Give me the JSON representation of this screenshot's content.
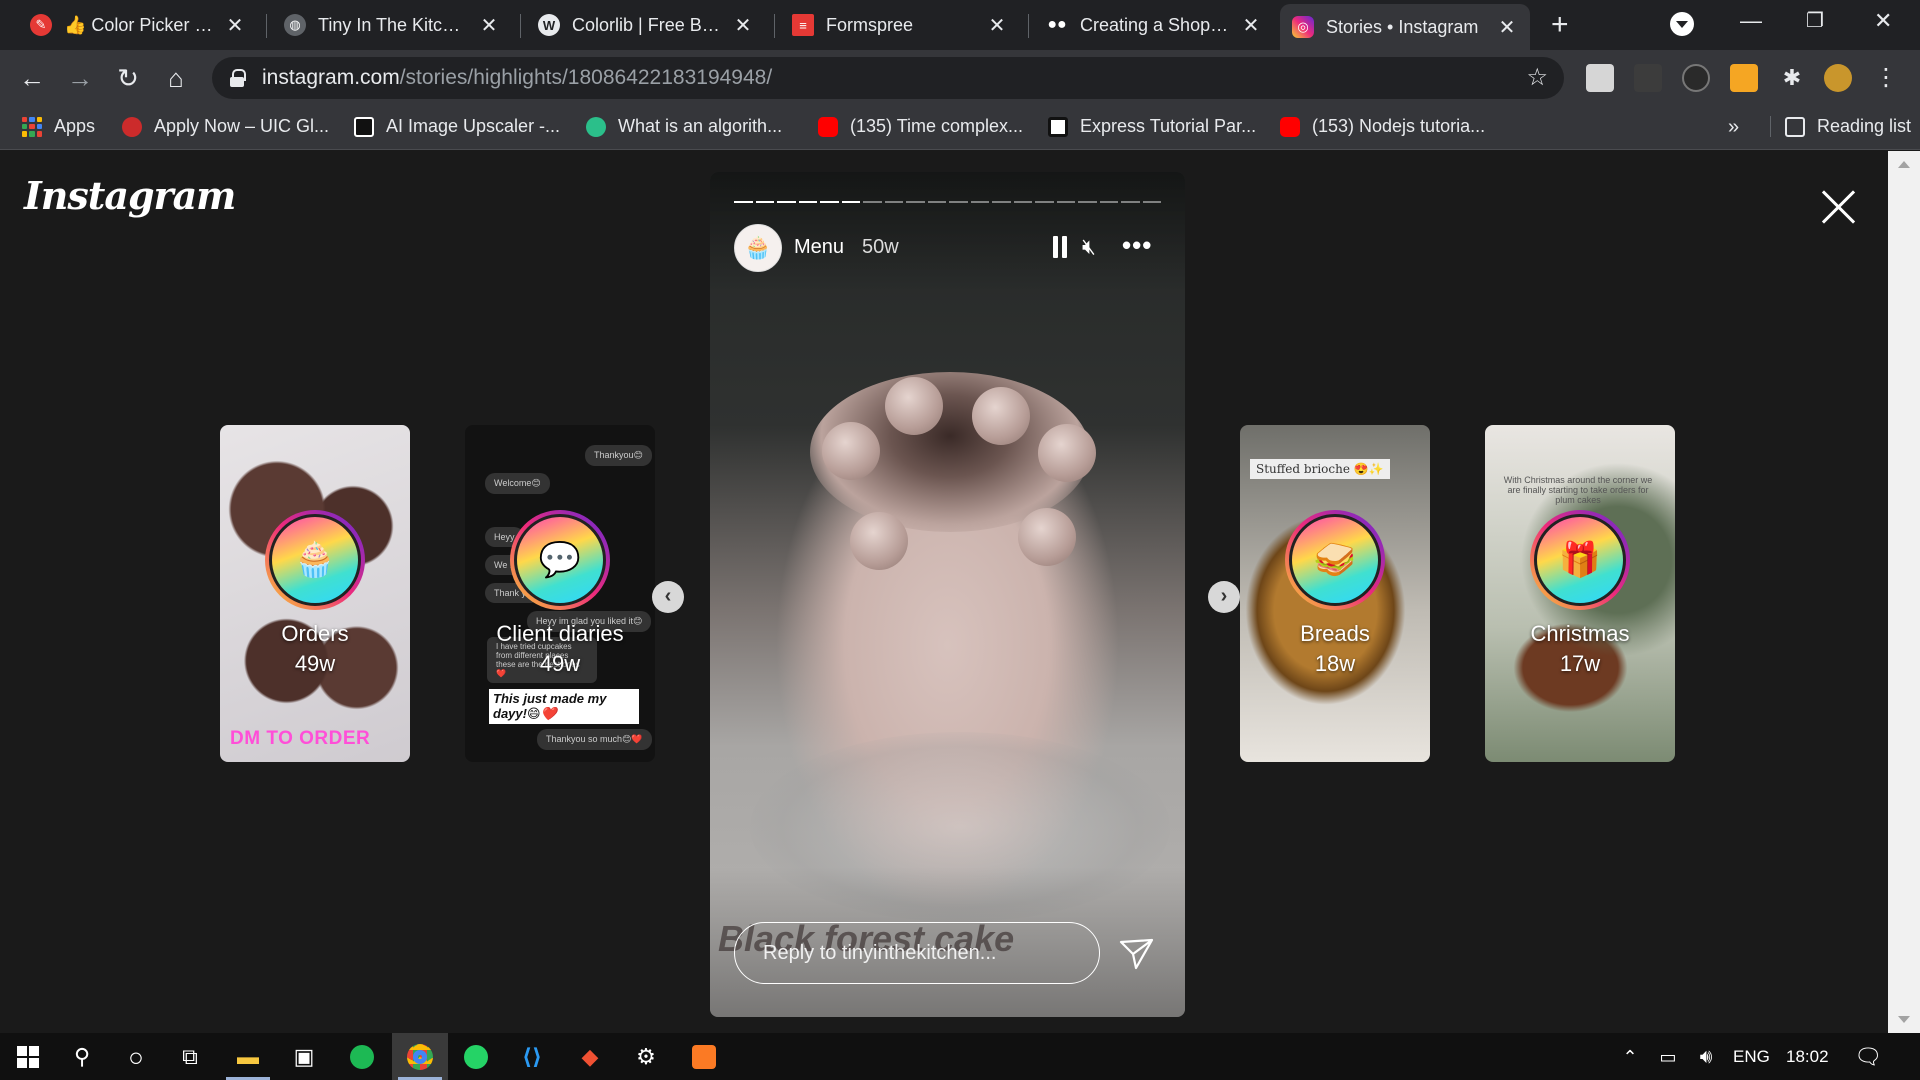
{
  "browser": {
    "tabs": [
      {
        "title": "👍 Color Picker onli",
        "icon": "color-picker-icon",
        "color": "#e53935"
      },
      {
        "title": "Tiny In The Kitchen",
        "icon": "globe-icon",
        "color": "#5f6368"
      },
      {
        "title": "Colorlib | Free Boots",
        "icon": "wordpress-icon",
        "color": "#5f6368"
      },
      {
        "title": "Formspree",
        "icon": "formspree-icon",
        "color": "#e53935"
      },
      {
        "title": "Creating a Shoppin",
        "icon": "medium-icon",
        "color": "#000000"
      },
      {
        "title": "Stories • Instagram",
        "icon": "instagram-icon",
        "color": "#d6249f"
      }
    ],
    "address": {
      "host": "instagram.com",
      "path": "/stories/highlights/18086422183194948/"
    },
    "bookmarks": [
      {
        "label": "Apps",
        "icon": "apps-grid-icon"
      },
      {
        "label": "Apply Now – UIC Gl...",
        "icon": "uic-icon",
        "color": "#cc2b2b"
      },
      {
        "label": "AI Image Upscaler -...",
        "icon": "upscaler-icon",
        "color": "#111111"
      },
      {
        "label": "What is an algorith...",
        "icon": "shield-icon",
        "color": "#2bbf8a"
      },
      {
        "label": "(135) Time complex...",
        "icon": "youtube-icon",
        "color": "#ff0000"
      },
      {
        "label": "Express Tutorial Par...",
        "icon": "express-icon",
        "color": "#111111"
      },
      {
        "label": "(153) Nodejs tutoria...",
        "icon": "youtube-icon",
        "color": "#ff0000"
      }
    ],
    "more_bookmarks": "»",
    "reading_list": "Reading list"
  },
  "instagram": {
    "logo": "Instagram",
    "story": {
      "username": "Menu",
      "age": "50w",
      "caption": "Black forest cake",
      "reply_placeholder": "Reply to tinyinthekitchen...",
      "segments_total": 20,
      "segments_done": 6
    },
    "highlights": [
      {
        "name": "Orders",
        "age": "49w",
        "caption": "DM TO ORDER",
        "icon": "cupcake-icon"
      },
      {
        "name": "Client diaries",
        "age": "49w",
        "caption": "",
        "icon": "chat-icon"
      },
      {
        "name": "Breads",
        "age": "18w",
        "caption": "Stuffed brioche 😍✨",
        "icon": "sandwich-icon"
      },
      {
        "name": "Christmas",
        "age": "17w",
        "caption": "",
        "icon": "gifts-icon"
      }
    ],
    "client_chat": {
      "bubbles": [
        "Thankyou😊",
        "Welcome😊",
        "Heyy",
        "We lo",
        "Thank yo",
        "Heyy im glad you liked it😊",
        "Thankyou so much😊❤️"
      ],
      "review": "I have tried cupcakes from different places these are the best ones❤️",
      "headline": "This just made my dayy!😄❤️"
    },
    "christmas_note": "With Christmas around the corner we are finally starting to take orders for plum cakes"
  },
  "taskbar": {
    "language": "ENG",
    "time": "18:02"
  }
}
